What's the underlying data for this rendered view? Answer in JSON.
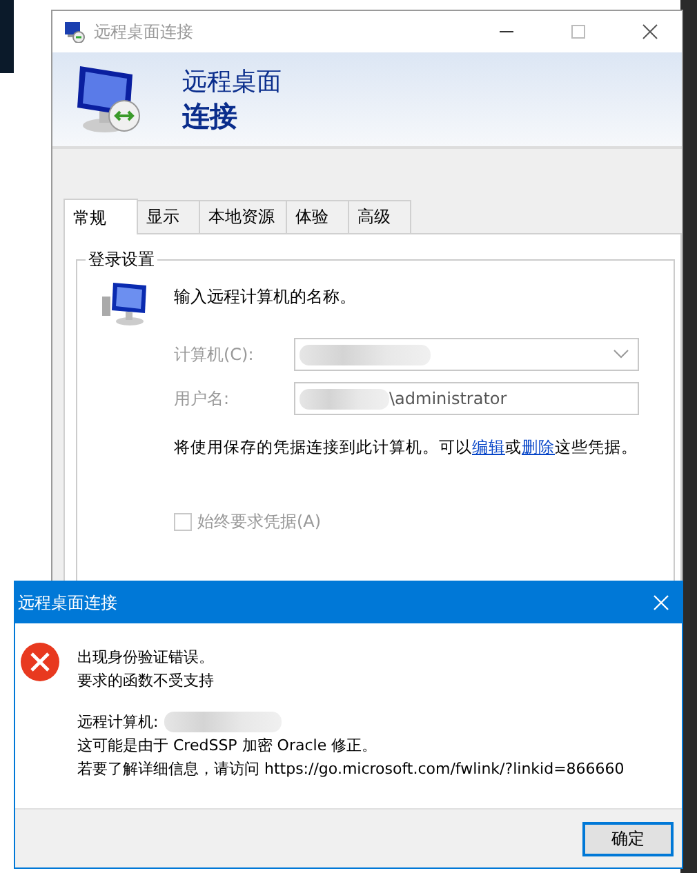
{
  "main_window": {
    "title": "远程桌面连接",
    "header": {
      "line_1": "远程桌面",
      "line_2": "连接"
    },
    "tabs": [
      {
        "label": "常规",
        "selected": true
      },
      {
        "label": "显示",
        "selected": false
      },
      {
        "label": "本地资源",
        "selected": false
      },
      {
        "label": "体验",
        "selected": false
      },
      {
        "label": "高级",
        "selected": false
      }
    ],
    "login_settings": {
      "legend": "登录设置",
      "prompt": "输入远程计算机的名称。",
      "computer_label": "计算机(C):",
      "username_label": "用户名:",
      "username_value": "\\administrator",
      "note": {
        "before": "将使用保存的凭据连接到此计算机。可以",
        "edit_link": "编辑",
        "middle": "或",
        "delete_link": "删除",
        "after": "这些凭据。"
      },
      "always_ask": {
        "label": "始终要求凭据(A)",
        "checked": false,
        "disabled": true
      }
    }
  },
  "error_dialog": {
    "title": "远程桌面连接",
    "messages": [
      "出现身份验证错误。",
      "要求的函数不受支持"
    ],
    "remote_label": "远程计算机:",
    "details": [
      "这可能是由于 CredSSP 加密 Oracle 修正。",
      "若要了解详细信息，请访问 https://go.microsoft.com/fwlink/?linkid=866660"
    ],
    "ok_button": "确定"
  }
}
